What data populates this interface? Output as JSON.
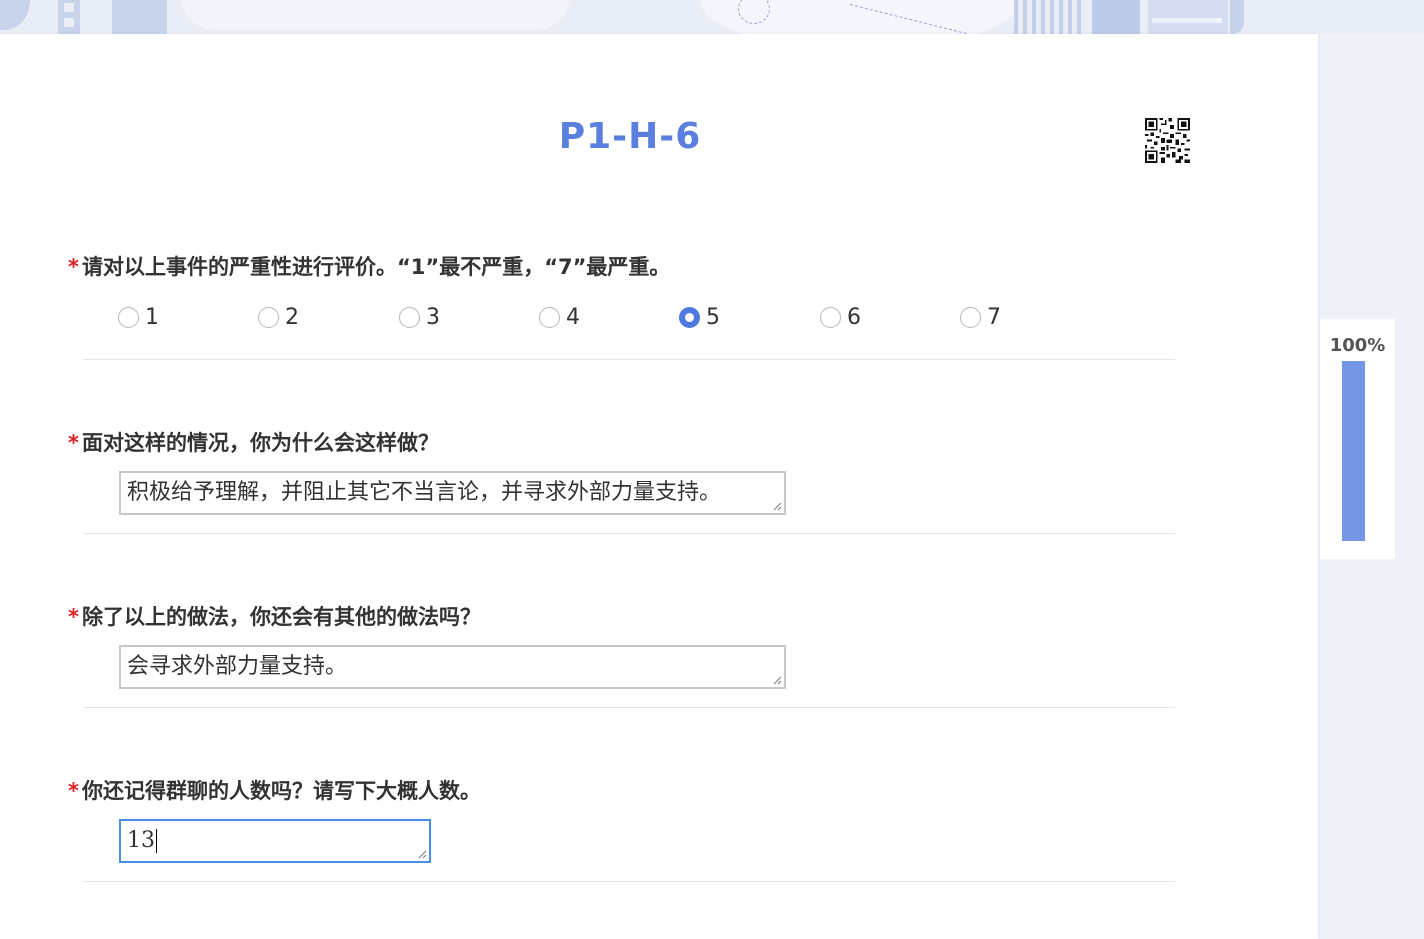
{
  "survey": {
    "title": "P1-H-6"
  },
  "questions": [
    {
      "required_mark": "*",
      "text": "请对以上事件的严重性进行评价。“1”最不严重，“7”最严重。",
      "options": [
        "1",
        "2",
        "3",
        "4",
        "5",
        "6",
        "7"
      ],
      "selected": "5"
    },
    {
      "required_mark": "*",
      "text": "面对这样的情况，你为什么会这样做？",
      "answer": "积极给予理解，并阻止其它不当言论，并寻求外部力量支持。"
    },
    {
      "required_mark": "*",
      "text": "除了以上的做法，你还会有其他的做法吗？",
      "answer": "会寻求外部力量支持。"
    },
    {
      "required_mark": "*",
      "text": "你还记得群聊的人数吗？请写下大概人数。",
      "answer": "13"
    }
  ],
  "progress": {
    "label": "100%",
    "fraction": 1.0
  },
  "colors": {
    "accent": "#5b7fde",
    "required": "#e02020",
    "progress_fill": "#7596e6",
    "focus_border": "#4a90e2"
  },
  "icons": {
    "qr": "qr-code-icon",
    "resize": "resize-grip-icon"
  }
}
